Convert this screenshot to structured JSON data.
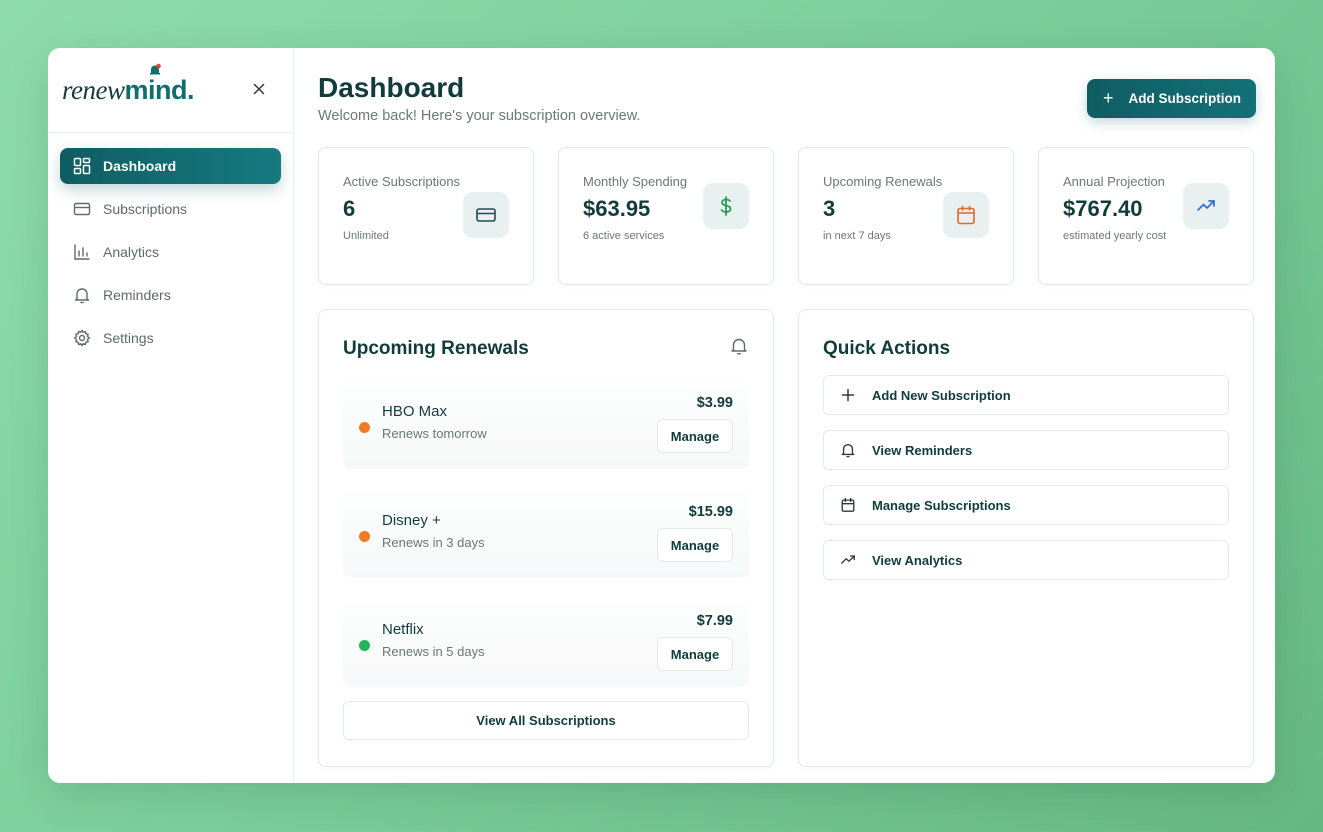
{
  "brand": {
    "part1": "renew",
    "part2": "mind."
  },
  "sidebar": {
    "items": [
      {
        "label": "Dashboard",
        "icon": "dashboard-grid-icon",
        "active": true
      },
      {
        "label": "Subscriptions",
        "icon": "credit-card-icon"
      },
      {
        "label": "Analytics",
        "icon": "bar-chart-icon"
      },
      {
        "label": "Reminders",
        "icon": "bell-icon"
      },
      {
        "label": "Settings",
        "icon": "gear-icon"
      }
    ]
  },
  "header": {
    "title": "Dashboard",
    "subtitle": "Welcome back! Here's your subscription overview.",
    "add_button": "Add Subscription"
  },
  "stats": [
    {
      "label": "Active Subscriptions",
      "value": "6",
      "note": "Unlimited",
      "icon": "credit-card-icon",
      "color": "#1f4d55"
    },
    {
      "label": "Monthly Spending",
      "value": "$63.95",
      "note": "6 active services",
      "icon": "dollar-icon",
      "color": "#1f9a52"
    },
    {
      "label": "Upcoming Renewals",
      "value": "3",
      "note": "in next 7 days",
      "icon": "calendar-icon",
      "color": "#e0692a"
    },
    {
      "label": "Annual Projection",
      "value": "$767.40",
      "note": "estimated yearly cost",
      "icon": "trending-up-icon",
      "color": "#2f6fd6"
    }
  ],
  "renewals": {
    "title": "Upcoming Renewals",
    "items": [
      {
        "name": "HBO Max",
        "when": "Renews tomorrow",
        "price": "$3.99",
        "action": "Manage",
        "status_color": "#f07a25"
      },
      {
        "name": "Disney +",
        "when": "Renews in 3 days",
        "price": "$15.99",
        "action": "Manage",
        "status_color": "#f07a25"
      },
      {
        "name": "Netflix",
        "when": "Renews in 5 days",
        "price": "$7.99",
        "action": "Manage",
        "status_color": "#22b55a"
      }
    ],
    "view_all": "View All Subscriptions"
  },
  "quick_actions": {
    "title": "Quick Actions",
    "items": [
      {
        "label": "Add New Subscription",
        "icon": "plus-icon"
      },
      {
        "label": "View Reminders",
        "icon": "bell-icon"
      },
      {
        "label": "Manage Subscriptions",
        "icon": "calendar-icon"
      },
      {
        "label": "View Analytics",
        "icon": "trending-up-icon"
      }
    ]
  },
  "colors": {
    "accent": "#116e6e",
    "logo_bell": "#e0443a"
  }
}
